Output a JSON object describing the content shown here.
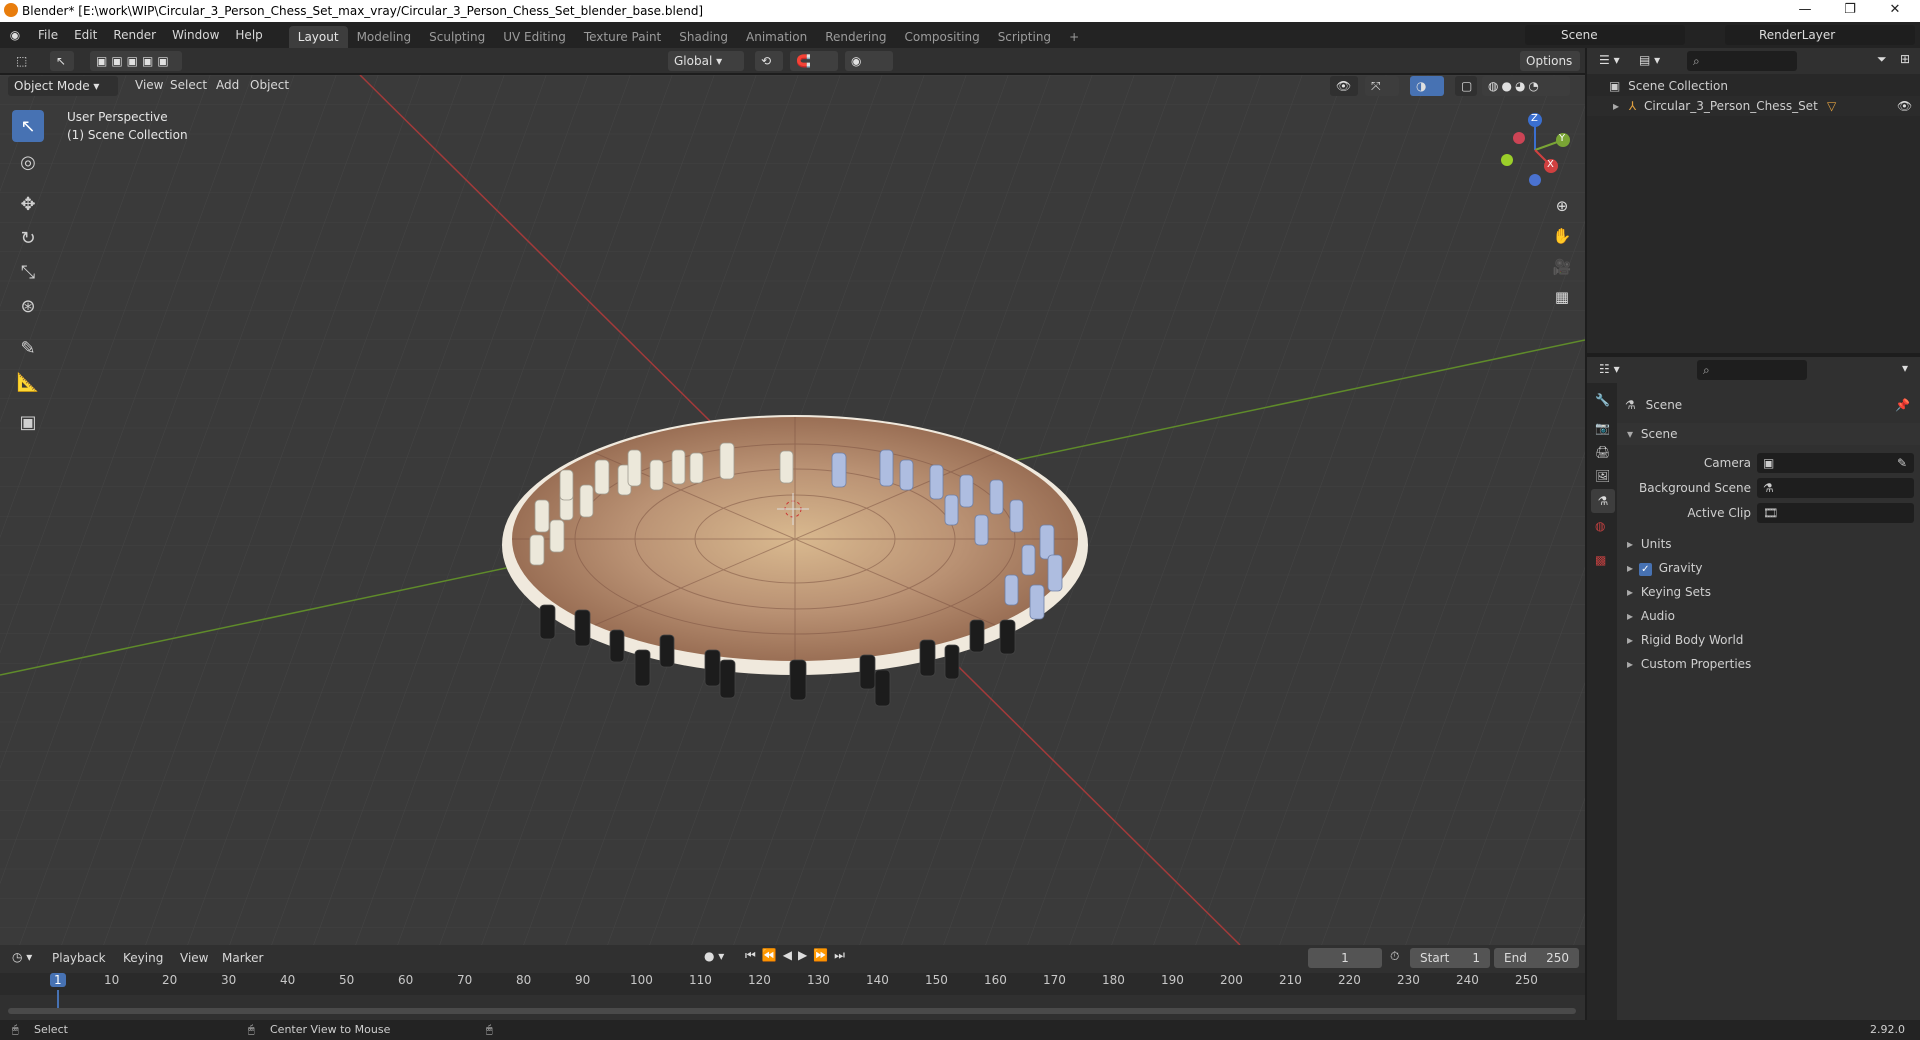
{
  "window": {
    "title": "Blender* [E:\\work\\WIP\\Circular_3_Person_Chess_Set_max_vray/Circular_3_Person_Chess_Set_blender_base.blend]",
    "controls": [
      "—",
      "❐",
      "✕"
    ]
  },
  "menubar": {
    "items": [
      "File",
      "Edit",
      "Render",
      "Window",
      "Help"
    ],
    "tabs": [
      "Layout",
      "Modeling",
      "Sculpting",
      "UV Editing",
      "Texture Paint",
      "Shading",
      "Animation",
      "Rendering",
      "Compositing",
      "Scripting"
    ],
    "active_tab": "Layout",
    "add_tab": "+",
    "scene_label": "Scene",
    "render_layer": "RenderLayer"
  },
  "viewport_header": {
    "mode": "Object Mode",
    "menus": [
      "View",
      "Select",
      "Add",
      "Object"
    ],
    "transform": "Global",
    "options": "Options"
  },
  "viewport": {
    "perspective": "User Perspective",
    "collection": "(1) Scene Collection",
    "gizmo": {
      "z": "Z",
      "y": "Y",
      "x": "X"
    }
  },
  "outliner": {
    "root": "Scene Collection",
    "items": [
      "Circular_3_Person_Chess_Set"
    ]
  },
  "properties": {
    "header": "Scene",
    "section": "Scene",
    "fields": [
      {
        "label": "Camera"
      },
      {
        "label": "Background Scene"
      },
      {
        "label": "Active Clip"
      }
    ],
    "subpanels": [
      "Units",
      "Gravity",
      "Keying Sets",
      "Audio",
      "Rigid Body World",
      "Custom Properties"
    ]
  },
  "timeline": {
    "menus": [
      "Playback",
      "Keying",
      "View",
      "Marker"
    ],
    "current_frame": "1",
    "start_label": "Start",
    "start": "1",
    "end_label": "End",
    "end": "250",
    "ticks": [
      "1",
      "10",
      "20",
      "30",
      "40",
      "50",
      "60",
      "70",
      "80",
      "90",
      "100",
      "110",
      "120",
      "130",
      "140",
      "150",
      "160",
      "170",
      "180",
      "190",
      "200",
      "210",
      "220",
      "230",
      "240",
      "250"
    ]
  },
  "statusbar": {
    "select": "Select",
    "center": "Center View to Mouse",
    "version": "2.92.0"
  },
  "colors": {
    "accent": "#4772b3",
    "axis_x": "#c0392b",
    "axis_y": "#6b9a2b"
  }
}
